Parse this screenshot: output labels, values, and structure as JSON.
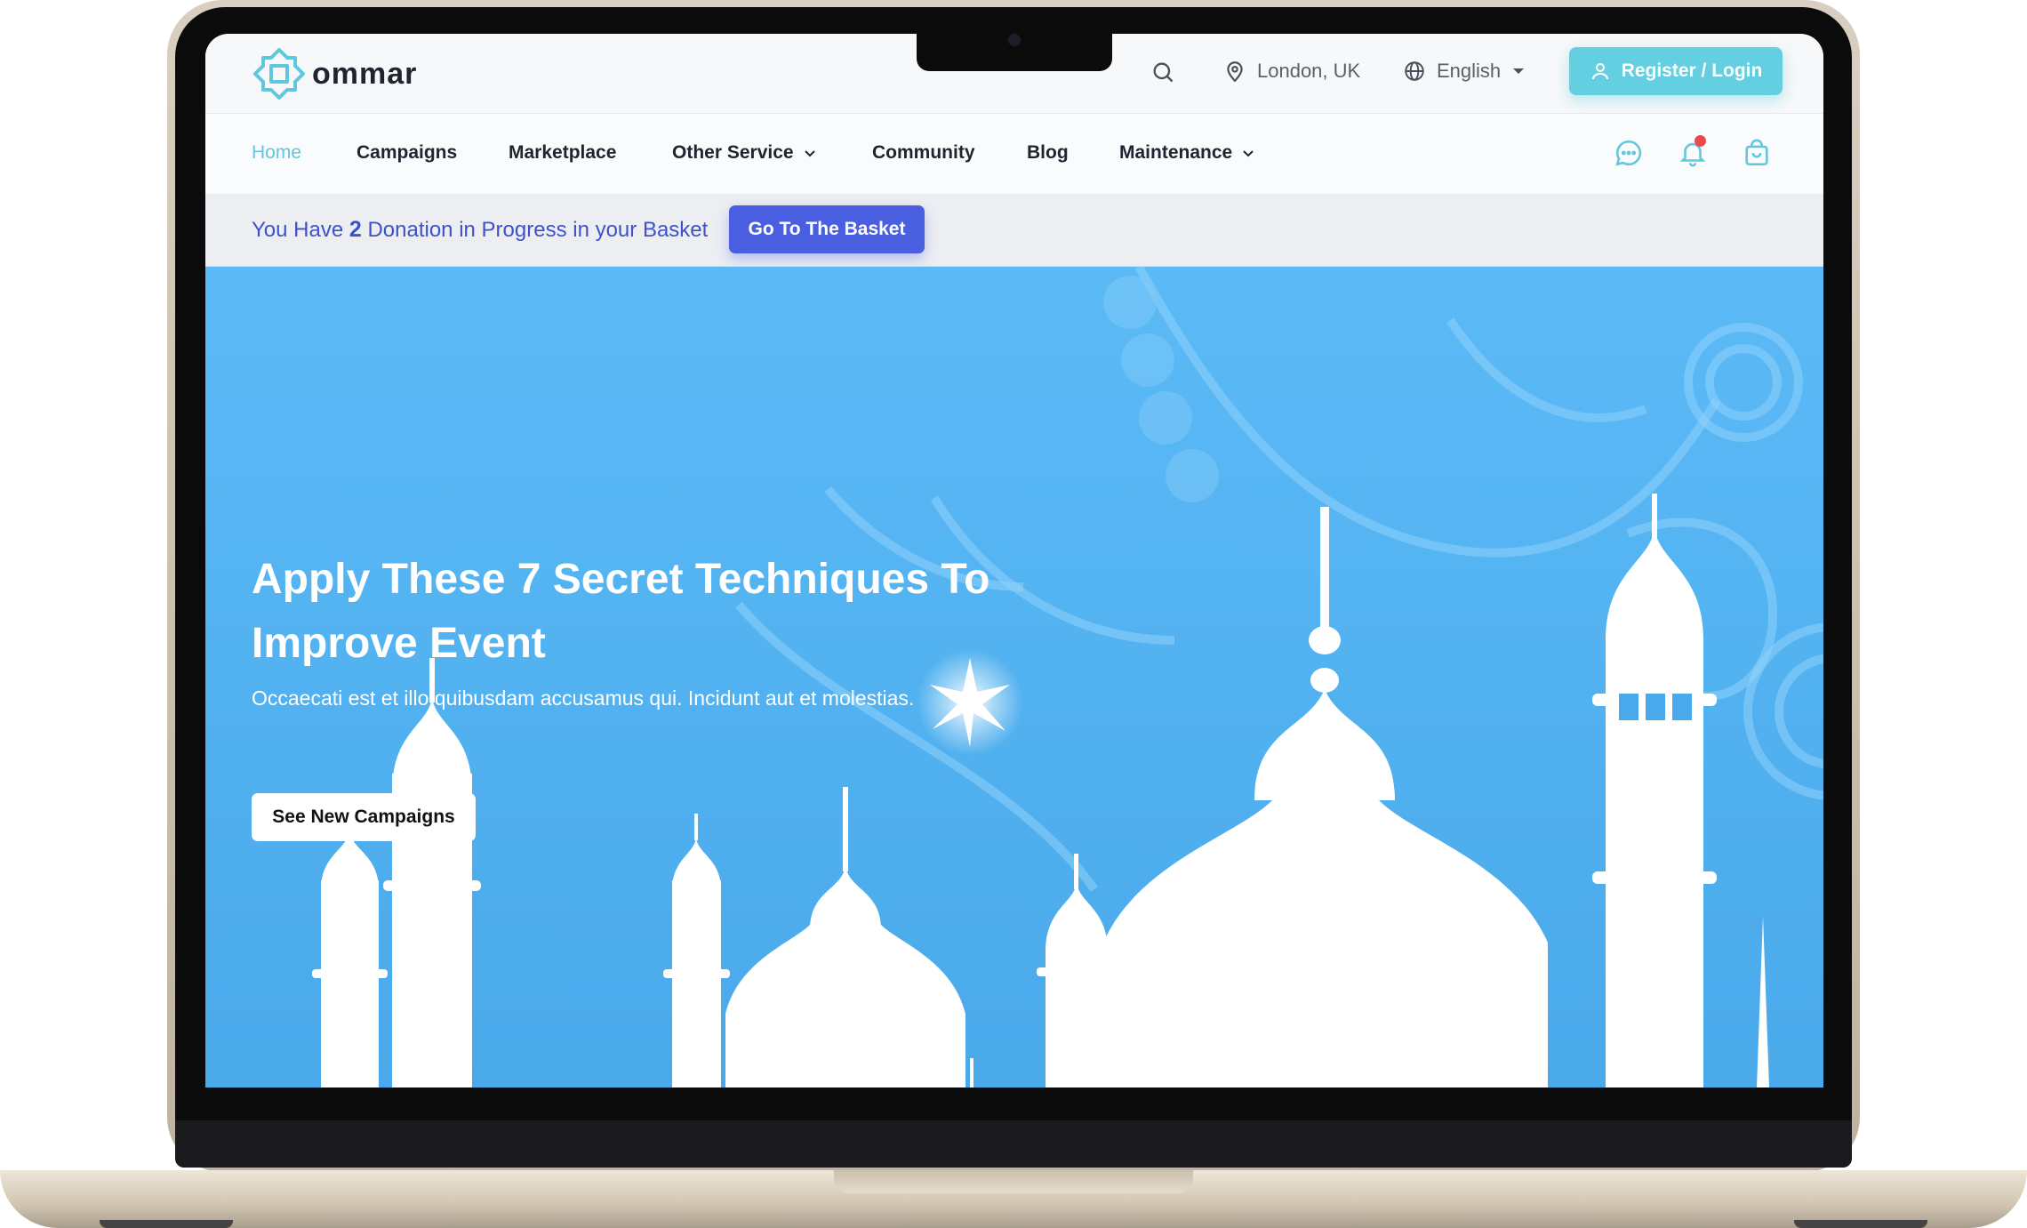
{
  "brand": {
    "name": "ommar"
  },
  "topbar": {
    "location": "London, UK",
    "language": "English",
    "register_label": "Register / Login"
  },
  "nav": {
    "items": [
      {
        "label": "Home"
      },
      {
        "label": "Campaigns"
      },
      {
        "label": "Marketplace"
      },
      {
        "label": "Other Service"
      },
      {
        "label": "Community"
      },
      {
        "label": "Blog"
      },
      {
        "label": "Maintenance"
      }
    ],
    "active": "Home"
  },
  "basket": {
    "prefix": "You Have ",
    "count": "2",
    "suffix": " Donation in Progress in your Basket",
    "button_label": "Go To The Basket"
  },
  "hero": {
    "title": "Apply These 7 Secret Techniques To Improve Event",
    "subtitle": "Occaecati est et illo quibusdam accusamus qui. Incidunt aut et molestias.",
    "cta_label": "See New Campaigns"
  },
  "colors": {
    "accent": "#63cfe0",
    "primary": "#4a5fe0",
    "hero_bg": "#59b8f4",
    "notification_dot": "#e94b4b"
  },
  "icons": {
    "search": "search-icon",
    "location": "map-pin-icon",
    "language": "globe-icon",
    "user": "user-icon",
    "chat": "chat-icon",
    "bell": "bell-icon",
    "bag": "shopping-bag-icon"
  }
}
